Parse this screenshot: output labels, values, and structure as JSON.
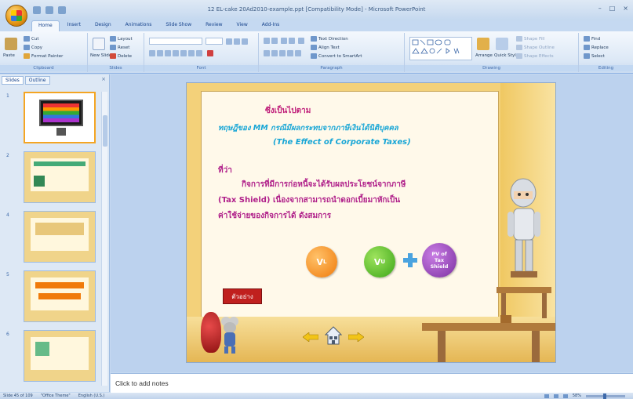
{
  "window": {
    "title": "12 EL-cake 20Ad2010-example.ppt [Compatibility Mode] - Microsoft PowerPoint",
    "controls": [
      "–",
      "□",
      "×"
    ]
  },
  "ribbon": {
    "tabs": [
      "Home",
      "Insert",
      "Design",
      "Animations",
      "Slide Show",
      "Review",
      "View",
      "Add-Ins"
    ],
    "active_tab": "Home",
    "groups": {
      "clipboard": {
        "label": "Clipboard",
        "paste": "Paste",
        "cut": "Cut",
        "copy": "Copy",
        "format_painter": "Format Painter"
      },
      "slides": {
        "label": "Slides",
        "new_slide": "New Slide",
        "layout": "Layout",
        "reset": "Reset",
        "delete": "Delete"
      },
      "font": {
        "label": "Font"
      },
      "paragraph": {
        "label": "Paragraph",
        "text_direction": "Text Direction",
        "align_text": "Align Text",
        "convert_smartart": "Convert to SmartArt"
      },
      "drawing": {
        "label": "Drawing",
        "arrange": "Arrange",
        "quick_styles": "Quick Styles",
        "shape_fill": "Shape Fill",
        "shape_outline": "Shape Outline",
        "shape_effects": "Shape Effects"
      },
      "editing": {
        "label": "Editing",
        "find": "Find",
        "replace": "Replace",
        "select": "Select"
      }
    }
  },
  "side_panel": {
    "tabs": [
      "Slides",
      "Outline"
    ],
    "active_tab": "Slides",
    "close": "×",
    "thumbnails": [
      {
        "number": "1",
        "selected": true
      },
      {
        "number": "2",
        "selected": false
      },
      {
        "number": "4",
        "selected": false
      },
      {
        "number": "5",
        "selected": false
      },
      {
        "number": "6",
        "selected": false
      }
    ]
  },
  "slide": {
    "subtitle": "ซึ่งเป็นไปตาม",
    "thai_line": "ทฤษฎีของ MM กรณีมีผลกระทบจากภาษีเงินได้นิติบุคคล",
    "english_line": "(The Effect of Corporate Taxes)",
    "para_1": "ที่ว่า",
    "para_2": "กิจการที่มีการก่อหนี้จะได้รับผลประโยชน์จากภาษี",
    "para_3": "(Tax Shield)  เนื่องจากสามารถนำดอกเบี้ยมาหักเป็น",
    "para_4": "ค่าใช้จ่ายของกิจการได้ ดังสมการ",
    "equation": {
      "vl": "V",
      "vl_sub": "L",
      "vu": "V",
      "vu_sub": "U",
      "pv_line1": "PV of",
      "pv_line2": "Tax",
      "pv_line3": "Shield"
    },
    "example_button": "ตัวอย่าง",
    "colors": {
      "heading": "#c0207b",
      "theory": "#18a6d6",
      "body": "#b0208a",
      "button": "#c0201e"
    }
  },
  "notes": {
    "placeholder": "Click to add notes"
  },
  "status": {
    "slide_info": "Slide 45 of 109",
    "theme": "\"Office Theme\"",
    "language": "English (U.S.)",
    "zoom": "58%"
  }
}
